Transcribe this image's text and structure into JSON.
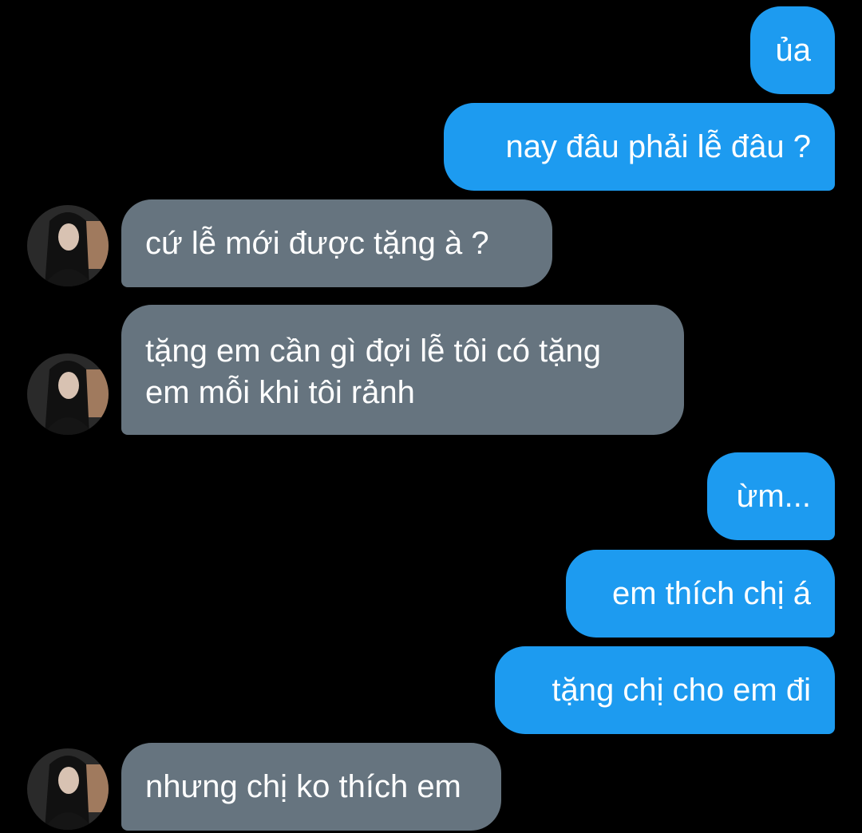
{
  "messages": [
    {
      "side": "sent",
      "text": "ủa"
    },
    {
      "side": "sent",
      "text": "nay đâu phải lễ đâu ?"
    },
    {
      "side": "received",
      "text": "cứ lễ mới được tặng à ?"
    },
    {
      "side": "received",
      "text": "tặng em cần gì đợi lễ tôi có tặng\nem mỗi khi tôi rảnh"
    },
    {
      "side": "sent",
      "text": "ừm..."
    },
    {
      "side": "sent",
      "text": "em thích chị á"
    },
    {
      "side": "sent",
      "text": "tặng chị cho em đi"
    },
    {
      "side": "received",
      "text": "nhưng chị ko thích em"
    }
  ],
  "contact": {
    "avatar_icon": "contact-avatar-icon"
  },
  "colors": {
    "background": "#000000",
    "sent_bubble": "#1d9bf0",
    "received_bubble": "#66747f",
    "text": "#ffffff"
  }
}
